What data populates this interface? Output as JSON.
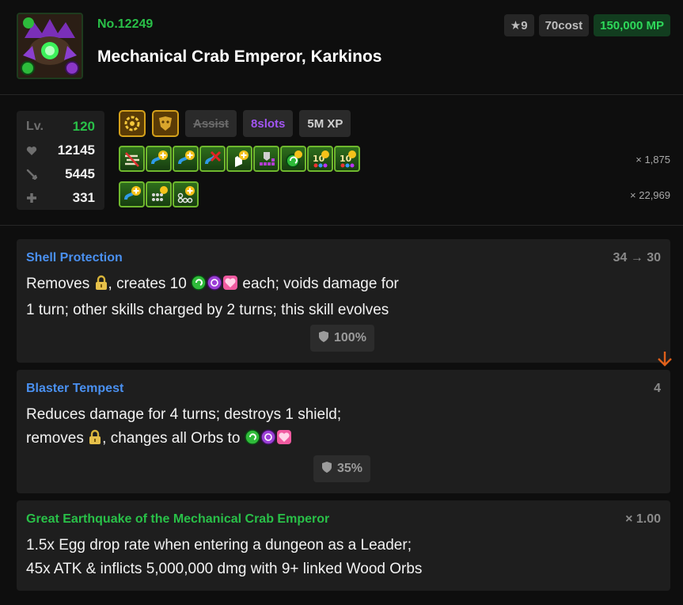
{
  "monster": {
    "number": "No.12249",
    "name": "Mechanical Crab Emperor, Karkinos",
    "rarity": "★9",
    "cost": "70cost",
    "mp": "150,000 MP",
    "portrait_icon": "crab-emperor-portrait",
    "attribute_colors": {
      "main": "#3fc23f",
      "sub": "#9b3fd6"
    }
  },
  "stats": {
    "level_label": "Lv.",
    "level": "120",
    "hp": "12145",
    "atk": "5445",
    "rcv": "331"
  },
  "types": {
    "icons": [
      "machine-type-icon",
      "god-type-icon"
    ],
    "assist": "Assist",
    "slots": "8slots",
    "xp": "5M XP"
  },
  "awakenings": {
    "row1": [
      "cloud-resist-awakening-icon",
      "skill-boost-plus-awakening-icon",
      "skill-boost-plus-awakening-icon",
      "skill-bind-resist-plus-awakening-icon",
      "time-extend-plus-awakening-icon",
      "l-unlock-awakening-icon",
      "wood-row-plus-awakening-icon",
      "ten-combo-plus-awakening-icon",
      "ten-combo-plus-awakening-icon"
    ],
    "row1_multiplier": "× 1,875",
    "row2": [
      "skill-boost-plus-awakening-icon",
      "no-skyfall-plus-awakening-icon",
      "blob-plus-awakening-icon"
    ],
    "row2_multiplier": "× 22,969"
  },
  "skills": [
    {
      "title": "Shell Protection",
      "cooldown": "34 → 30",
      "line1_a": "Removes",
      "line1_b": ", creates 10",
      "line1_c": "each; voids damage for",
      "line2": "1 turn; other skills charged by 2 turns; this skill evolves",
      "shield": "100%"
    },
    {
      "title": "Blaster Tempest",
      "cooldown": "4",
      "line1": "Reduces damage for 4 turns; destroys 1 shield;",
      "line2_a": "removes",
      "line2_b": ", changes all Orbs to",
      "shield": "35%"
    }
  ],
  "leader": {
    "title": "Great Earthquake of the Mechanical Crab Emperor",
    "multiplier": "× 1.00",
    "line1": "1.5x Egg drop rate when entering a dungeon as a Leader;",
    "line2": "45x ATK & inflicts 5,000,000 dmg with 9+ linked Wood Orbs"
  }
}
